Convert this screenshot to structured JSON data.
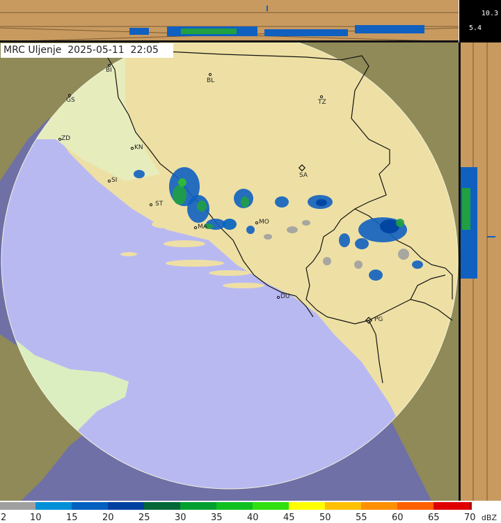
{
  "header": {
    "station": "MRC Uljenje",
    "date": "2025-05-11",
    "time": "22:05"
  },
  "altitude_scale": {
    "top_value": "10.3",
    "mid_value": "5.4"
  },
  "cities": [
    {
      "code": "BI"
    },
    {
      "code": "BL"
    },
    {
      "code": "GS"
    },
    {
      "code": "TZ"
    },
    {
      "code": "ZD"
    },
    {
      "code": "KN"
    },
    {
      "code": "SA"
    },
    {
      "code": "SI"
    },
    {
      "code": "ST"
    },
    {
      "code": "MO"
    },
    {
      "code": "MA"
    },
    {
      "code": "DU"
    },
    {
      "code": "PG"
    }
  ],
  "legend": {
    "unit": "dBZ",
    "ticks": [
      "2",
      "10",
      "15",
      "20",
      "25",
      "30",
      "35",
      "40",
      "45",
      "50",
      "55",
      "60",
      "65",
      "70"
    ],
    "colors": [
      "#a0a0a0",
      "#0090d8",
      "#0060c0",
      "#0040a0",
      "#006838",
      "#00a030",
      "#10c020",
      "#30e010",
      "#ffff00",
      "#ffc000",
      "#ff9000",
      "#ff6000",
      "#e00000",
      "#b00000",
      "#900090"
    ]
  },
  "colors": {
    "sea": "#b8b8f0",
    "land": "#efe2a8",
    "outside_land": "#8a8a50",
    "outside_sea": "#6e6ea0",
    "side_panel": "#c89a60",
    "border_line": "#111111"
  }
}
